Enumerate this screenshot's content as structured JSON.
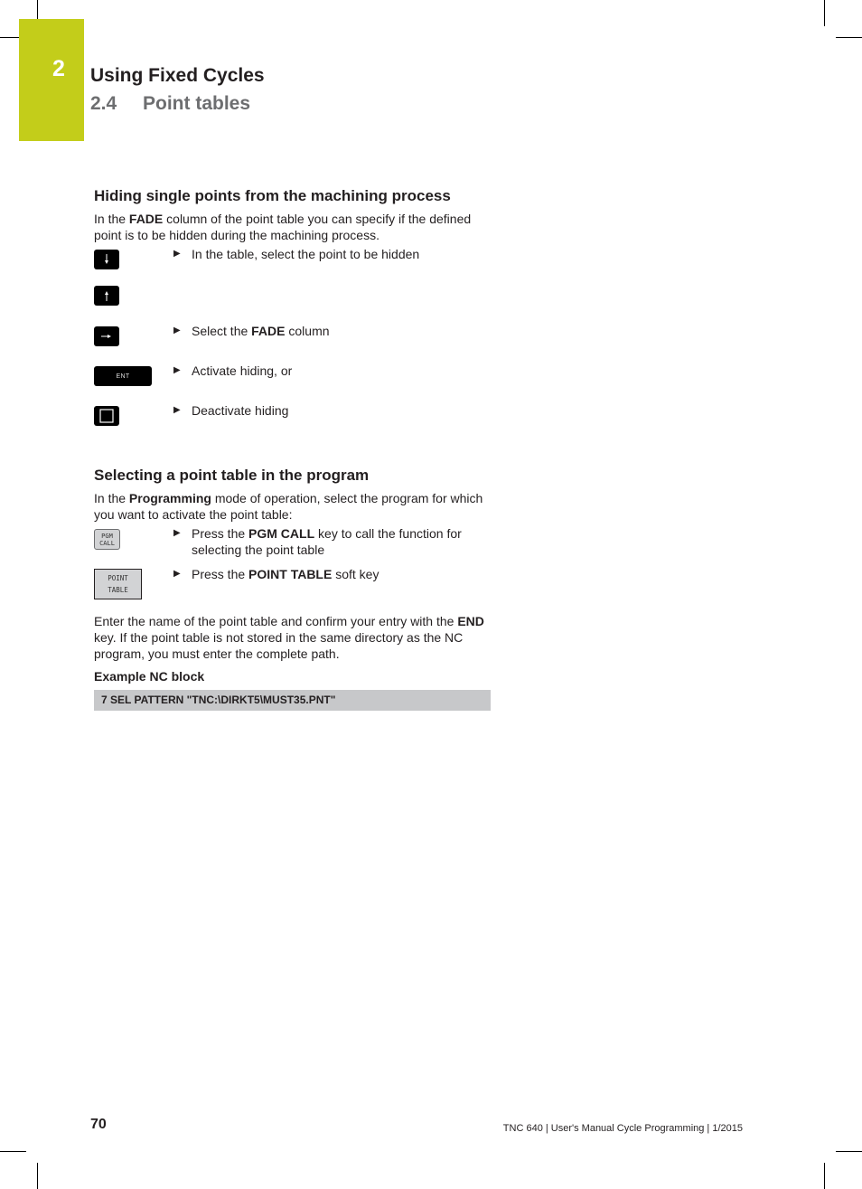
{
  "header": {
    "chapter_number": "2",
    "chapter_title": "Using Fixed Cycles",
    "section_number": "2.4",
    "section_title": "Point tables",
    "accent_color": "#c3cd1a"
  },
  "section1": {
    "heading": "Hiding single points from the machining process",
    "intro": {
      "pre": "In the ",
      "bold": "FADE",
      "post": " column of the point table you can specify if the defined point is to be hidden during the machining process."
    },
    "keys": [
      {
        "icon": "arrow-down-key-icon",
        "label": ""
      },
      {
        "icon": "arrow-up-key-icon",
        "label": ""
      },
      {
        "icon": "arrow-right-key-icon",
        "label": ""
      },
      {
        "icon": "ent-key-icon",
        "label": "ENT"
      },
      {
        "icon": "no-ent-key-icon",
        "label": ""
      }
    ],
    "steps": [
      {
        "pre": "In the table, select the point to be hidden",
        "bold": "",
        "post": ""
      },
      {
        "pre": "Select the ",
        "bold": "FADE",
        "post": " column"
      },
      {
        "pre": "Activate hiding, or",
        "bold": "",
        "post": ""
      },
      {
        "pre": "Deactivate hiding",
        "bold": "",
        "post": ""
      }
    ]
  },
  "section2": {
    "heading": "Selecting a point table in the program",
    "intro": {
      "pre": "In the ",
      "bold": "Programming",
      "post": " mode of operation, select the program for which you want to activate the point table:"
    },
    "keys": [
      {
        "icon": "pgm-call-key-icon",
        "line1": "PGM",
        "line2": "CALL"
      },
      {
        "icon": "point-table-softkey-icon",
        "line1": "POINT",
        "line2": "TABLE"
      }
    ],
    "steps": [
      {
        "pre": "Press the ",
        "bold": "PGM CALL",
        "post": " key to call the function for selecting the point table"
      },
      {
        "pre": "Press the ",
        "bold": "POINT TABLE",
        "post": " soft key"
      }
    ],
    "outro": {
      "pre": "Enter the name of the point table and confirm your entry with the ",
      "bold": "END",
      "post": " key. If the point table is not stored in the same directory as the NC program, you must enter the complete path."
    },
    "example_label": "Example NC block",
    "code": "7 SEL PATTERN \"TNC:\\DIRKT5\\MUST35.PNT\""
  },
  "footer": {
    "page_number": "70",
    "text": "TNC 640 | User's Manual Cycle Programming | 1/2015"
  },
  "step_arrow": "▶"
}
